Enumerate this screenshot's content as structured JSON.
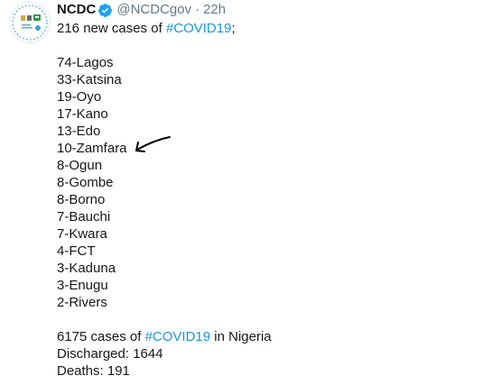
{
  "tweet": {
    "author_name": "NCDC",
    "handle": "@NCDCgov",
    "separator": "·",
    "time": "22h",
    "intro_prefix": "216 new cases of ",
    "intro_hashtag": "#COVID19",
    "intro_suffix": ";",
    "states": [
      "74-Lagos",
      "33-Katsina",
      "19-Oyo",
      "17-Kano",
      "13-Edo",
      "10-Zamfara",
      "8-Ogun",
      "8-Gombe",
      "8-Borno",
      "7-Bauchi",
      "7-Kwara",
      "4-FCT",
      "3-Kaduna",
      "3-Enugu",
      "2-Rivers"
    ],
    "total_prefix": "6175 cases of ",
    "total_hashtag": "#COVID19",
    "total_suffix": " in Nigeria",
    "discharged": "Discharged: 1644",
    "deaths": "Deaths: 191"
  },
  "colors": {
    "text": "#14171a",
    "secondary": "#657786",
    "link": "#1b95e0",
    "verified": "#1da1f2",
    "annotation": "#000000"
  }
}
